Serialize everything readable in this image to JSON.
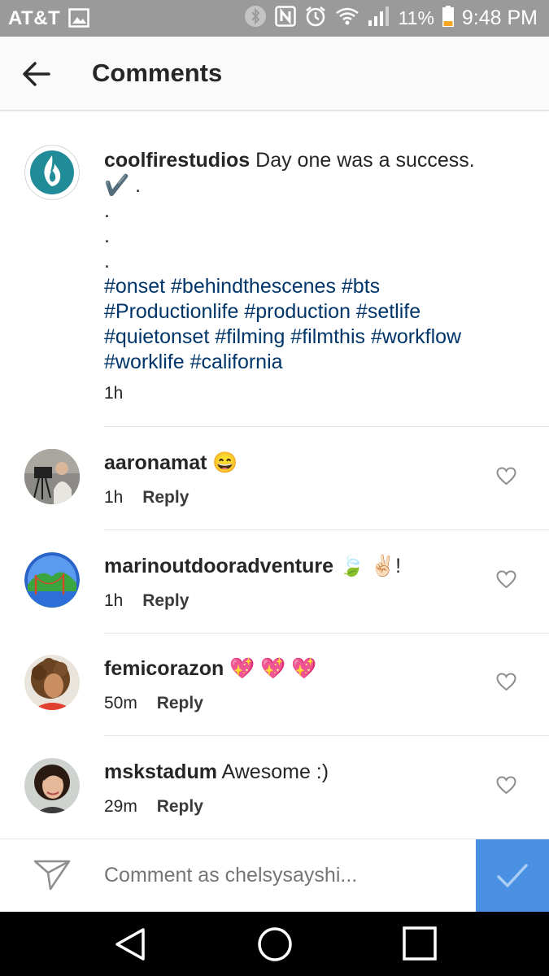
{
  "status_bar": {
    "carrier": "AT&T",
    "battery_percent": "11%",
    "time": "9:48 PM",
    "icons": [
      "gallery-icon",
      "bluetooth-icon",
      "nfc-icon",
      "alarm-icon",
      "wifi-icon",
      "signal-icon",
      "battery-icon"
    ]
  },
  "header": {
    "title": "Comments"
  },
  "caption": {
    "username": "coolfirestudios",
    "text": "Day one was a success.",
    "check": "✔️",
    "trailing": ".",
    "dots": [
      ".",
      ".",
      "."
    ],
    "hashtags": "#onset #behindthescenes #bts #Productionlife #production #setlife #quietonset #filming #filmthis #workflow #worklife #california",
    "time": "1h"
  },
  "comments": [
    {
      "username": "aaronamat",
      "text": "😄",
      "time": "1h",
      "reply_label": "Reply"
    },
    {
      "username": "marinoutdooradventure",
      "text": "🍃 ✌🏻!",
      "time": "1h",
      "reply_label": "Reply"
    },
    {
      "username": "femicorazon",
      "text": "💖 💖 💖",
      "time": "50m",
      "reply_label": "Reply"
    },
    {
      "username": "mskstadum",
      "text": "Awesome :)",
      "time": "29m",
      "reply_label": "Reply"
    }
  ],
  "composer": {
    "placeholder": "Comment as chelsysayshi..."
  },
  "colors": {
    "hashtag": "#003569",
    "post_button": "#4a90e2",
    "status_bar": "#9a9a9a"
  }
}
